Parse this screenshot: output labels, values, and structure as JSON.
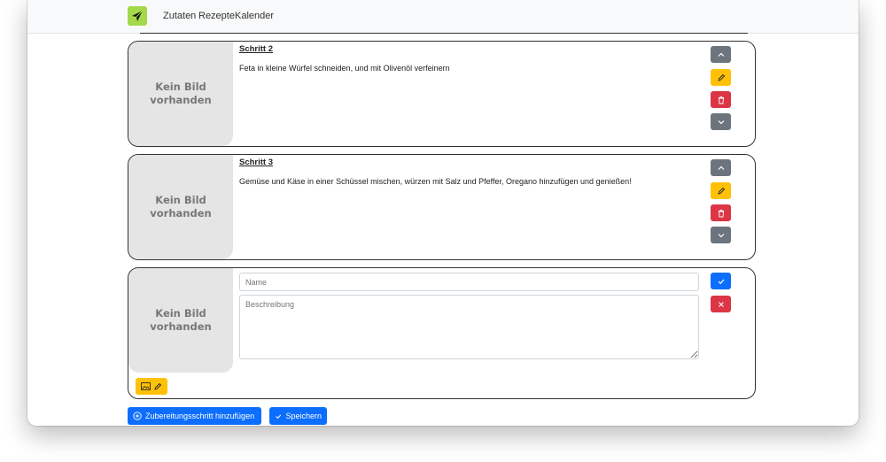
{
  "nav": {
    "links": [
      "Zutaten",
      "Rezepte",
      "Kalender"
    ]
  },
  "placeholder_image_text": "Kein Bild vorhanden",
  "steps": [
    {
      "title": "Schritt 2",
      "description": "Feta in kleine Würfel schneiden, und mit Olivenöl verfeinern"
    },
    {
      "title": "Schritt 3",
      "description": "Gemüse und Käse in einer Schüssel mischen, würzen mit Salz und Pfeffer, Oregano hinzufügen und genießen!"
    }
  ],
  "new_step": {
    "name_placeholder": "Name",
    "description_placeholder": "Beschreibung"
  },
  "actions": {
    "add_step_label": "Zubereitungsschritt hinzufügen",
    "save_label": "Speichern"
  },
  "colors": {
    "primary": "#0d6efd",
    "warning": "#ffc107",
    "danger": "#dc3545",
    "secondary": "#6c757d",
    "logo": "#a3d94a"
  },
  "icons": {
    "logo": "paper-plane-icon",
    "move_up": "chevron-up-icon",
    "edit": "pencil-icon",
    "delete": "trash-icon",
    "move_down": "chevron-down-icon",
    "confirm": "check-icon",
    "cancel": "x-icon",
    "image": "image-icon",
    "add": "plus-circle-icon",
    "save": "check-icon"
  }
}
